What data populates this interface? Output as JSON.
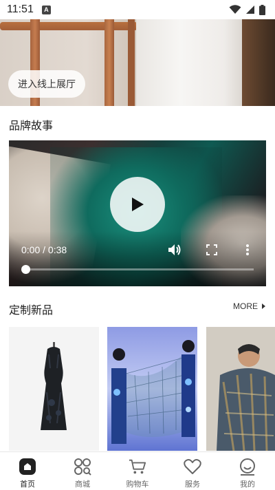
{
  "status_bar": {
    "time": "11:51",
    "notification_letter": "A"
  },
  "hero": {
    "enter_button": "进入线上展厅"
  },
  "brand_story": {
    "title": "品牌故事",
    "video": {
      "time": "0:00 / 0:38",
      "progress": 0.0
    }
  },
  "custom_new": {
    "title": "定制新品",
    "more_label": "MORE"
  },
  "products": [
    {
      "image": "dark-floral-qipao"
    },
    {
      "image": "blue-net-fashion-installation"
    },
    {
      "image": "patterned-coat-model"
    }
  ],
  "tabbar": {
    "items": [
      {
        "label": "首页",
        "icon": "home-icon",
        "active": true
      },
      {
        "label": "商城",
        "icon": "grid-icon",
        "active": false
      },
      {
        "label": "购物车",
        "icon": "cart-icon",
        "active": false
      },
      {
        "label": "服务",
        "icon": "heart-icon",
        "active": false
      },
      {
        "label": "我的",
        "icon": "smile-icon",
        "active": false
      }
    ]
  },
  "colors": {
    "accent": "#222222",
    "tab_inactive": "#666666"
  }
}
